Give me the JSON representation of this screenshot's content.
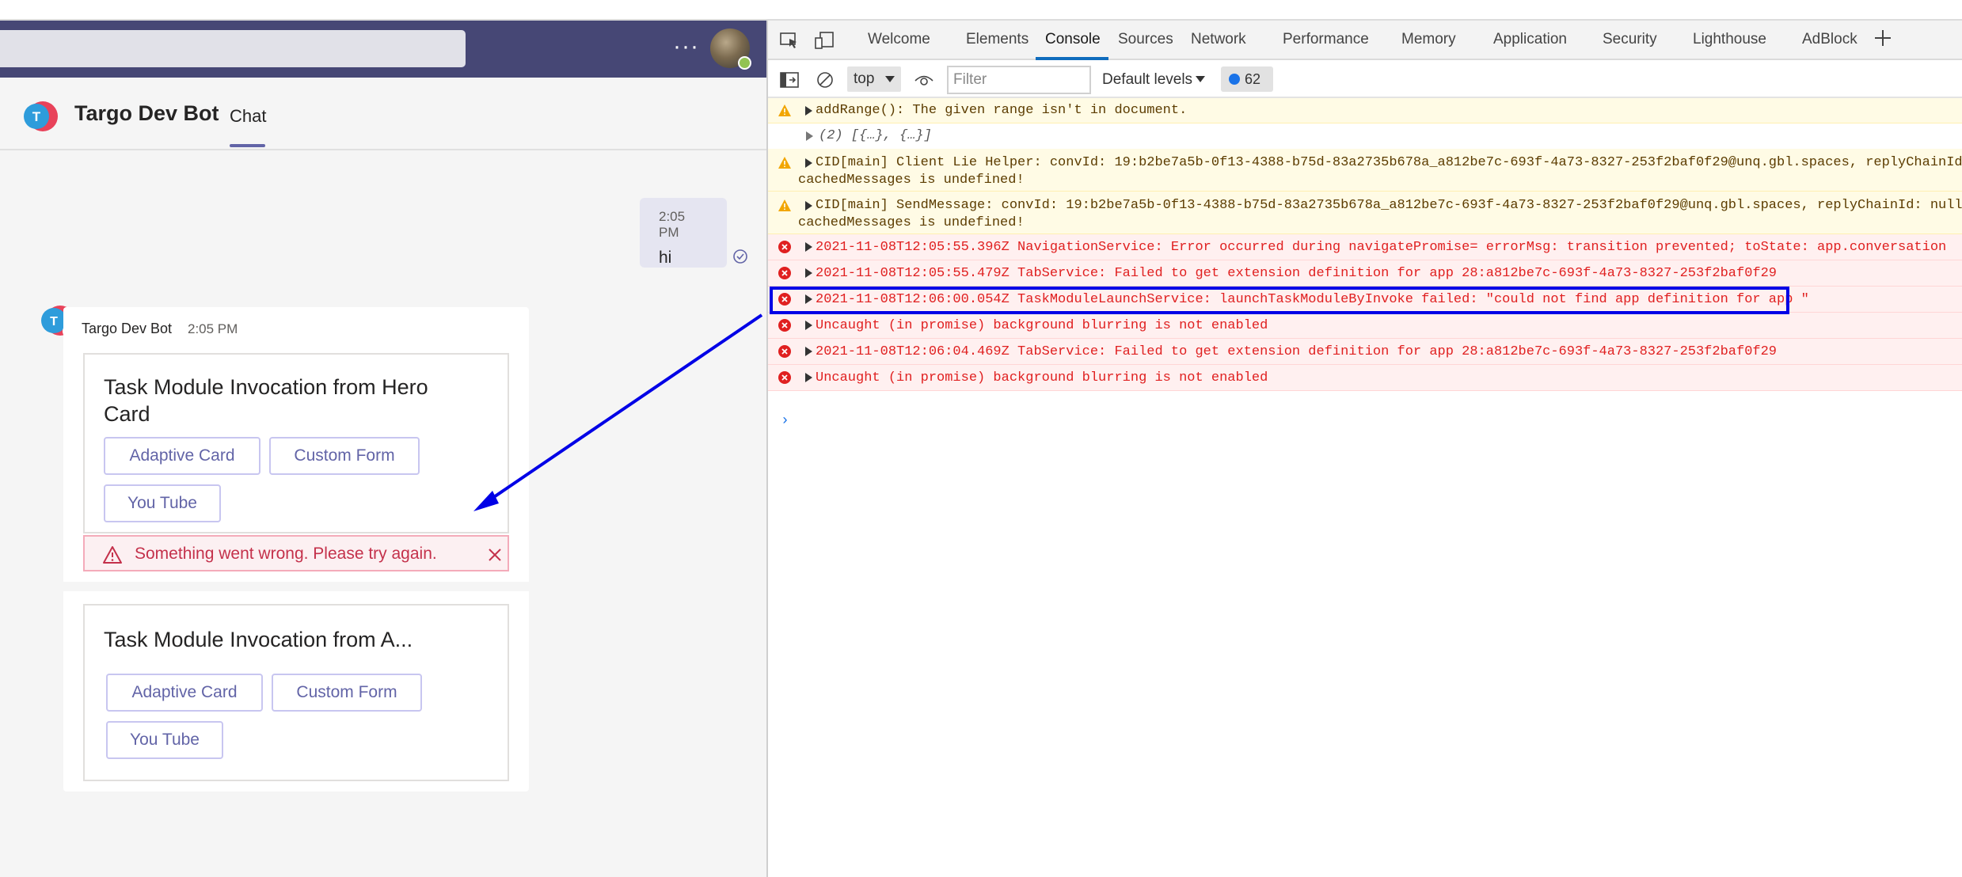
{
  "teams": {
    "more_label": "···",
    "bot_title": "Targo Dev Bot",
    "chat_tab": "Chat",
    "user_message": {
      "time": "2:05 PM",
      "text": "hi"
    },
    "bot_message": {
      "name": "Targo Dev Bot",
      "time": "2:05 PM"
    },
    "card1": {
      "title": "Task Module Invocation from Hero Card",
      "buttons": [
        "Adaptive Card",
        "Custom Form",
        "You Tube"
      ]
    },
    "error": {
      "text": "Something went wrong. Please try again."
    },
    "card2": {
      "title": "Task Module Invocation from A...",
      "buttons": [
        "Adaptive Card",
        "Custom Form",
        "You Tube"
      ]
    },
    "colors": {
      "header": "#464775",
      "accent": "#6264a7",
      "error": "#c4314b",
      "presence": "#92c353"
    }
  },
  "devtools": {
    "tabs": [
      "Welcome",
      "Elements",
      "Console",
      "Sources",
      "Network",
      "Performance",
      "Memory",
      "Application",
      "Security",
      "Lighthouse",
      "AdBlock"
    ],
    "active_tab": "Console",
    "toolbar": {
      "context": "top",
      "filter_placeholder": "Filter",
      "levels": "Default levels",
      "issues_count": "62"
    },
    "console": [
      {
        "level": "warning",
        "text": "addRange(): The given range isn't in document."
      },
      {
        "level": "info",
        "text": "(2) [{…}, {…}]"
      },
      {
        "level": "warning",
        "text": "CID[main] Client Lie Helper: convId: 19:b2be7a5b-0f13-4388-b75d-83a2735b678a_a812be7c-693f-4a73-8327-253f2baf0f29@unq.gbl.spaces, replyChainId: nu",
        "text2": "cachedMessages is undefined!"
      },
      {
        "level": "warning",
        "text": "CID[main] SendMessage: convId: 19:b2be7a5b-0f13-4388-b75d-83a2735b678a_a812be7c-693f-4a73-8327-253f2baf0f29@unq.gbl.spaces, replyChainId: null::",
        "text2": "cachedMessages is undefined!"
      },
      {
        "level": "error",
        "text": "2021-11-08T12:05:55.396Z NavigationService: Error occurred during navigatePromise= errorMsg: transition prevented; toState: app.conversation"
      },
      {
        "level": "error",
        "text": "2021-11-08T12:05:55.479Z TabService: Failed to get extension definition for app 28:a812be7c-693f-4a73-8327-253f2baf0f29"
      },
      {
        "level": "error",
        "text": "2021-11-08T12:06:00.054Z TaskModuleLaunchService: launchTaskModuleByInvoke failed: \"could not find app definition for app \""
      },
      {
        "level": "error",
        "text": "Uncaught (in promise) background blurring is not enabled"
      },
      {
        "level": "error",
        "text": "2021-11-08T12:06:04.469Z TabService: Failed to get extension definition for app 28:a812be7c-693f-4a73-8327-253f2baf0f29"
      },
      {
        "level": "error",
        "text": "Uncaught (in promise) background blurring is not enabled"
      }
    ],
    "prompt": "›"
  },
  "annotation": {
    "highlight_color": "#0000e6"
  }
}
